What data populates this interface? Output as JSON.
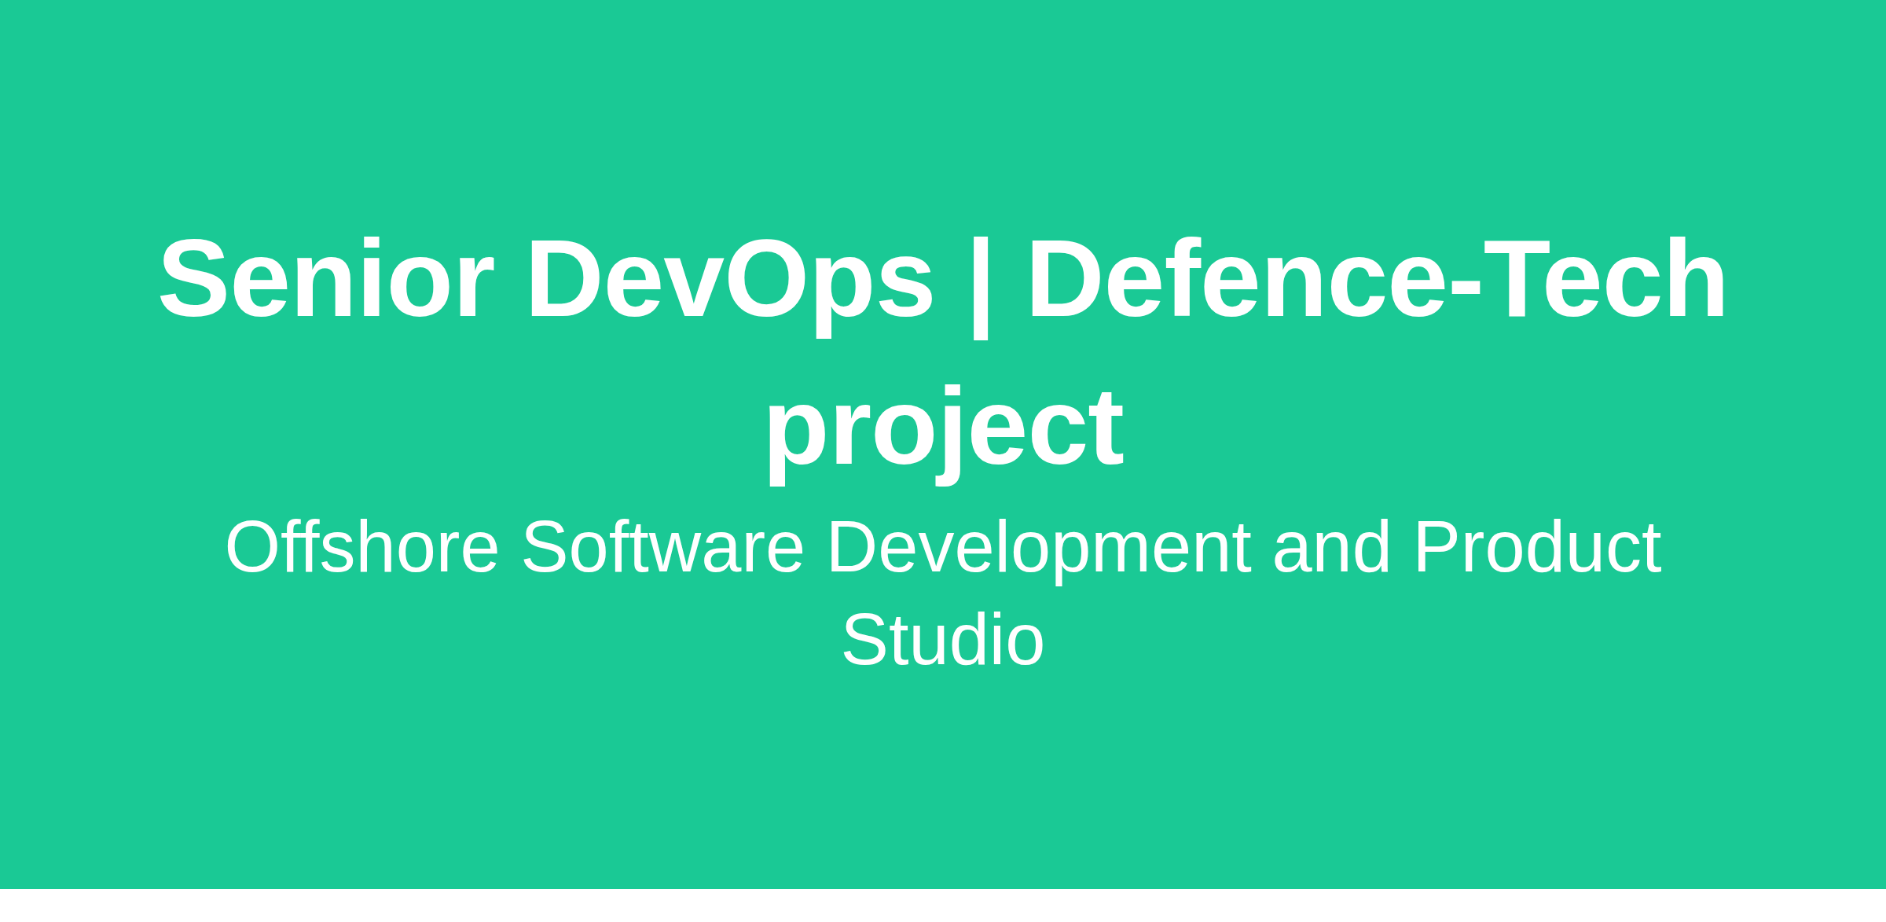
{
  "hero": {
    "title": "Senior DevOps | Defence-Tech project",
    "subtitle": "Offshore Software Development and Product Studio"
  }
}
